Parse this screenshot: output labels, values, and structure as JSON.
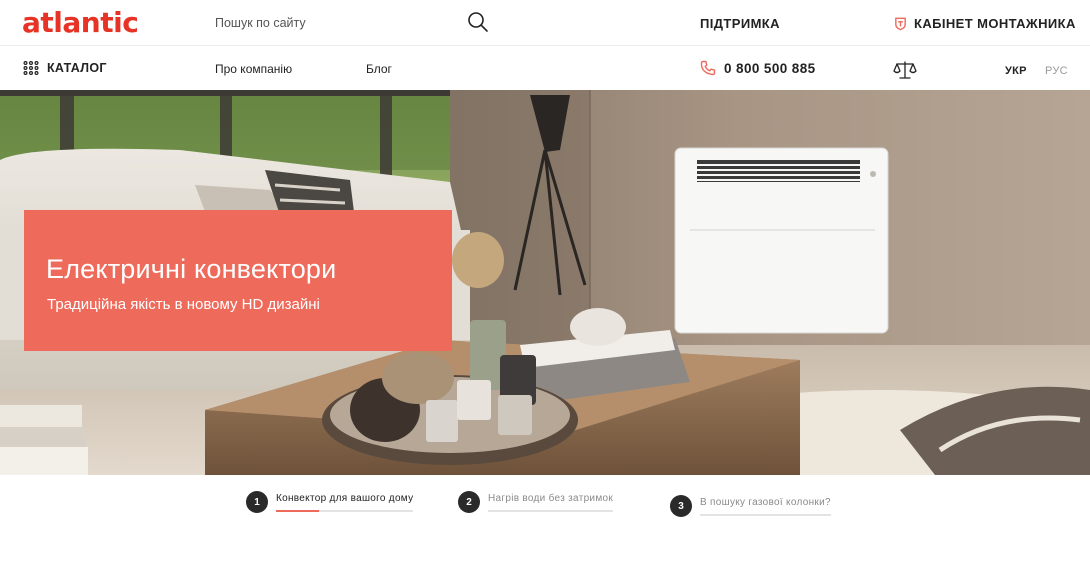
{
  "header": {
    "logo_text": "atlantic",
    "brand_color": "#e63325",
    "search": {
      "placeholder": "Пошук по сайту"
    },
    "support_label": "ПІДТРИМКА",
    "cabinet_label": "КАБІНЕТ МОНТАЖНИКА",
    "icons": {
      "search": "search-icon",
      "cabinet": "installer-badge-icon"
    }
  },
  "nav": {
    "catalog_label": "КАТАЛОГ",
    "links": [
      {
        "label": "Про компанію"
      },
      {
        "label": "Блог"
      }
    ],
    "phone": "0 800 500 885",
    "languages": [
      {
        "label": "УКР",
        "active": true
      },
      {
        "label": "РУС",
        "active": false
      }
    ],
    "icons": {
      "catalog": "grid-dots-icon",
      "phone": "phone-icon",
      "compare": "scales-compare-icon"
    }
  },
  "hero": {
    "title": "Електричні конвектори",
    "subtitle": "Традиційна якість в новому HD дизайні",
    "accent_color": "#ee6a5b"
  },
  "slides": [
    {
      "number": "1",
      "label": "Конвектор для вашого дому",
      "active": true,
      "progress": 0.31
    },
    {
      "number": "2",
      "label": "Нагрів води без затримок",
      "active": false,
      "progress": 0
    },
    {
      "number": "3",
      "label": "В пошуку газової колонки?",
      "active": false,
      "progress": 0
    }
  ]
}
